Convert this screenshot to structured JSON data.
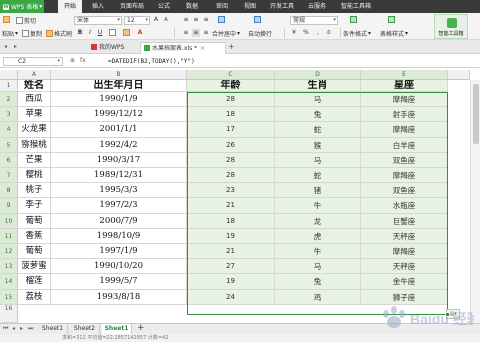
{
  "app": {
    "name": "WPS 表格"
  },
  "menu": [
    {
      "label": "开始",
      "active": true
    },
    {
      "label": "插入"
    },
    {
      "label": "页面布局"
    },
    {
      "label": "公式"
    },
    {
      "label": "数据"
    },
    {
      "label": "审阅"
    },
    {
      "label": "视图"
    },
    {
      "label": "开发工具"
    },
    {
      "label": "云服务"
    },
    {
      "label": "智能工具箱"
    }
  ],
  "ribbon": {
    "cut": "剪切",
    "paste": "粘贴",
    "copy": "复制",
    "format_painter": "格式刷",
    "font_name": "宋体",
    "font_size": "12",
    "merge_center": "合并居中",
    "wrap_text": "自动换行",
    "number_format": "常规",
    "currency_symbol": "¥",
    "percent_symbol": "%",
    "conditional_format": "条件格式",
    "table_style": "表格样式",
    "smart_toolbox": "智能工具箱"
  },
  "doc_tabs": [
    {
      "label": "我的WPS"
    },
    {
      "label": "水果档案表.xls *",
      "active": true
    }
  ],
  "formula_bar": {
    "cell_ref": "C2",
    "formula": "=DATEDIF(B2,TODAY(),\"Y\")"
  },
  "columns": [
    "A",
    "B",
    "C",
    "D",
    "E"
  ],
  "table": {
    "headers": [
      "姓名",
      "出生年月日",
      "年龄",
      "生肖",
      "星座"
    ],
    "rows": [
      {
        "n": "2",
        "cells": [
          "西瓜",
          "1990/1/9",
          "28",
          "马",
          "摩羯座"
        ]
      },
      {
        "n": "3",
        "cells": [
          "苹果",
          "1999/12/12",
          "18",
          "兔",
          "射手座"
        ]
      },
      {
        "n": "4",
        "cells": [
          "火龙果",
          "2001/1/1",
          "17",
          "蛇",
          "摩羯座"
        ]
      },
      {
        "n": "5",
        "cells": [
          "猕猴桃",
          "1992/4/2",
          "26",
          "猴",
          "白羊座"
        ]
      },
      {
        "n": "6",
        "cells": [
          "芒果",
          "1990/3/17",
          "28",
          "马",
          "双鱼座"
        ]
      },
      {
        "n": "7",
        "cells": [
          "樱桃",
          "1989/12/31",
          "28",
          "蛇",
          "摩羯座"
        ]
      },
      {
        "n": "8",
        "cells": [
          "桃子",
          "1995/3/3",
          "23",
          "猪",
          "双鱼座"
        ]
      },
      {
        "n": "9",
        "cells": [
          "李子",
          "1997/2/3",
          "21",
          "牛",
          "水瓶座"
        ]
      },
      {
        "n": "10",
        "cells": [
          "葡萄",
          "2000/7/9",
          "18",
          "龙",
          "巨蟹座"
        ]
      },
      {
        "n": "11",
        "cells": [
          "香蕉",
          "1998/10/9",
          "19",
          "虎",
          "天秤座"
        ]
      },
      {
        "n": "12",
        "cells": [
          "葡萄",
          "1997/1/9",
          "21",
          "牛",
          "摩羯座"
        ]
      },
      {
        "n": "13",
        "cells": [
          "菠萝蜜",
          "1990/10/20",
          "27",
          "马",
          "天秤座"
        ]
      },
      {
        "n": "14",
        "cells": [
          "榴莲",
          "1999/5/7",
          "19",
          "兔",
          "金牛座"
        ]
      },
      {
        "n": "15",
        "cells": [
          "荔枝",
          "1993/8/18",
          "24",
          "鸡",
          "狮子座"
        ]
      }
    ]
  },
  "sheets": [
    {
      "label": "Sheet1"
    },
    {
      "label": "Sheet2"
    },
    {
      "label": "Sheet1",
      "active": true
    }
  ],
  "status": {
    "text": "求和=312   平均值=22.2857142857   计数=42"
  },
  "watermark": {
    "text": "Baidu 经验"
  },
  "colors": {
    "accent": "#3ba744",
    "selection": "#e7f2e2",
    "selection_border": "#2f8f3a"
  }
}
